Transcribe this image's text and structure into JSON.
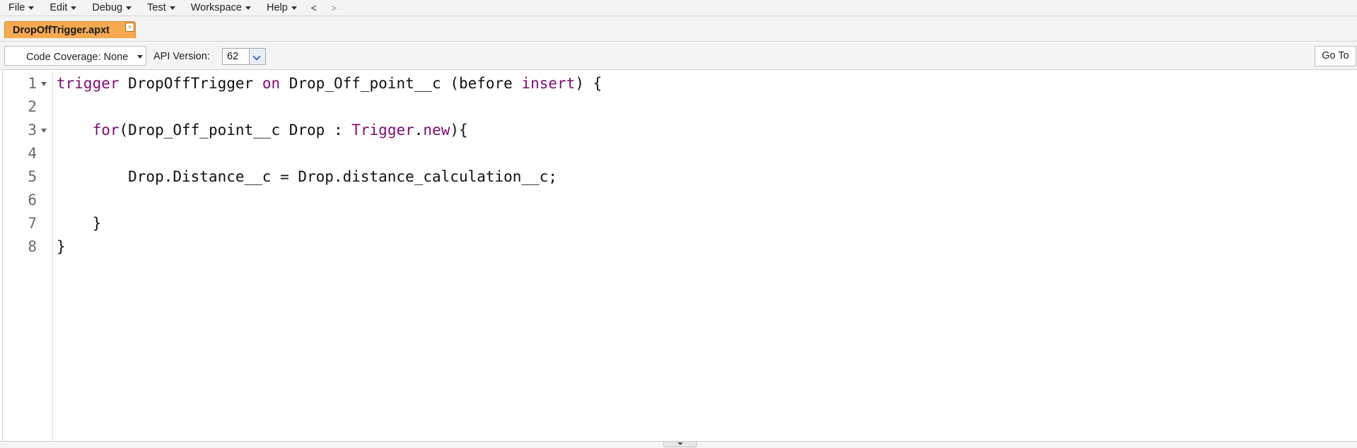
{
  "menu": {
    "items": [
      {
        "label": "File"
      },
      {
        "label": "Edit"
      },
      {
        "label": "Debug"
      },
      {
        "label": "Test"
      },
      {
        "label": "Workspace"
      },
      {
        "label": "Help"
      }
    ],
    "back": "<",
    "forward": ">"
  },
  "tabs": [
    {
      "label": "DropOffTrigger.apxt",
      "active": true,
      "close_label": "×"
    }
  ],
  "toolbar": {
    "coverage_label": "Code Coverage: None",
    "api_label": "API Version:",
    "api_value": "62",
    "goto_label": "Go To"
  },
  "editor": {
    "lines": [
      {
        "num": "1",
        "foldable": true
      },
      {
        "num": "2",
        "foldable": false
      },
      {
        "num": "3",
        "foldable": true
      },
      {
        "num": "4",
        "foldable": false
      },
      {
        "num": "5",
        "foldable": false
      },
      {
        "num": "6",
        "foldable": false
      },
      {
        "num": "7",
        "foldable": false
      },
      {
        "num": "8",
        "foldable": false
      }
    ],
    "code": {
      "l1": {
        "kw_trigger": "trigger",
        "name": " DropOffTrigger ",
        "kw_on": "on",
        "obj": " Drop_Off_point__c (before ",
        "kw_insert": "insert",
        "end": ") {"
      },
      "l3": {
        "indent": "    ",
        "kw_for": "for",
        "mid": "(Drop_Off_point__c Drop : ",
        "kw_trig": "Trigger",
        "dot": ".",
        "kw_new": "new",
        "end": "){"
      },
      "l5": {
        "text": "        Drop.Distance__c = Drop.distance_calculation__c;"
      },
      "l7": {
        "text": "    }"
      },
      "l8": {
        "text": "}"
      }
    },
    "colors": {
      "keyword": "#7f0b76",
      "text": "#111111",
      "tab_active": "#f6a94e"
    }
  }
}
